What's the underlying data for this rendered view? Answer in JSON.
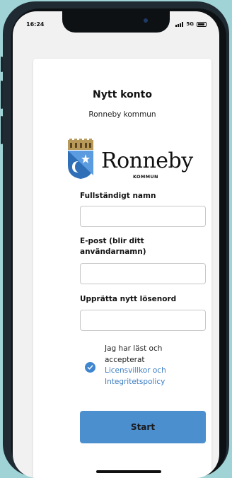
{
  "status_bar": {
    "time": "16:24",
    "network": "5G",
    "icons": [
      "signal-icon",
      "battery-icon"
    ]
  },
  "form": {
    "title": "Nytt konto",
    "subtitle": "Ronneby kommun",
    "logo": {
      "name": "Ronneby",
      "sub": "KOMMUN"
    },
    "fields": [
      {
        "label": "Fullständigt namn",
        "value": "",
        "placeholder": ""
      },
      {
        "label": "E-post (blir ditt användarnamn)",
        "value": "",
        "placeholder": ""
      },
      {
        "label": "Upprätta nytt lösenord",
        "value": "",
        "placeholder": ""
      }
    ],
    "terms": {
      "checked": true,
      "text": "Jag har läst och accepterat",
      "link": "Licensvillkor och Integritetspolicy"
    },
    "submit_label": "Start"
  },
  "colors": {
    "background": "#9fd3d6",
    "accent": "#4c8fcf",
    "checkbox": "#3f86cf",
    "link": "#3b7dc1"
  }
}
